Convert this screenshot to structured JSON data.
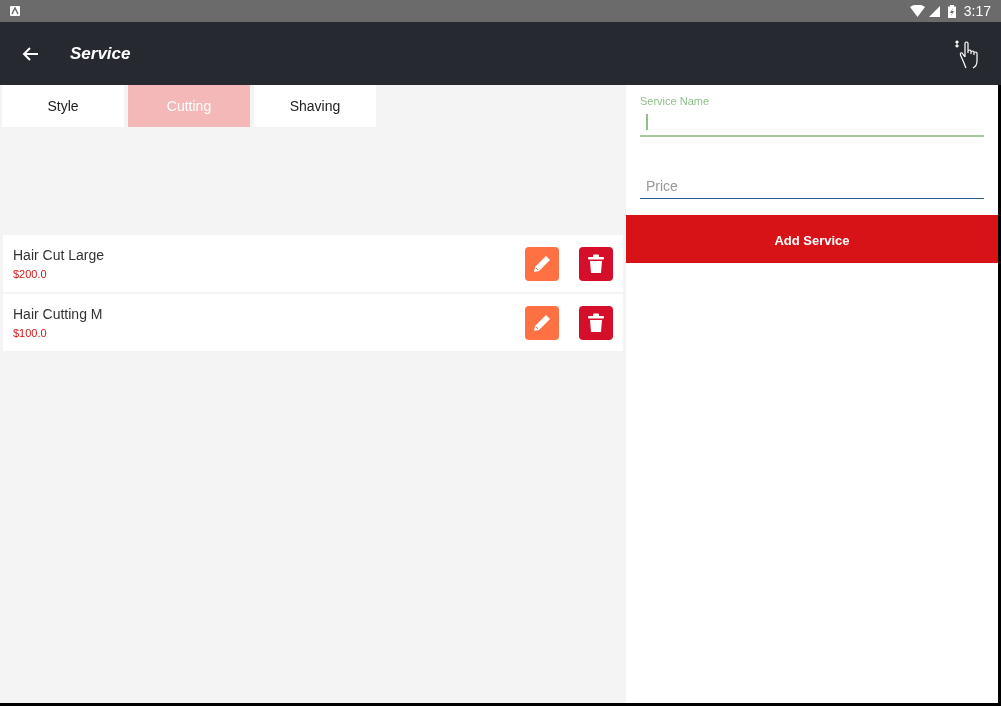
{
  "status_bar": {
    "time": "3:17"
  },
  "app_bar": {
    "title": "Service"
  },
  "tabs": [
    {
      "label": "Style",
      "selected": false
    },
    {
      "label": "Cutting",
      "selected": true
    },
    {
      "label": "Shaving",
      "selected": false
    }
  ],
  "services": [
    {
      "name": "Hair Cut Large",
      "price": "$200.0"
    },
    {
      "name": "Hair Cutting M",
      "price": "$100.0"
    }
  ],
  "form": {
    "fields": [
      {
        "label": "Service Name",
        "focused": true
      },
      {
        "placeholder": "Price",
        "focused": false
      }
    ],
    "button": "Add Service"
  }
}
